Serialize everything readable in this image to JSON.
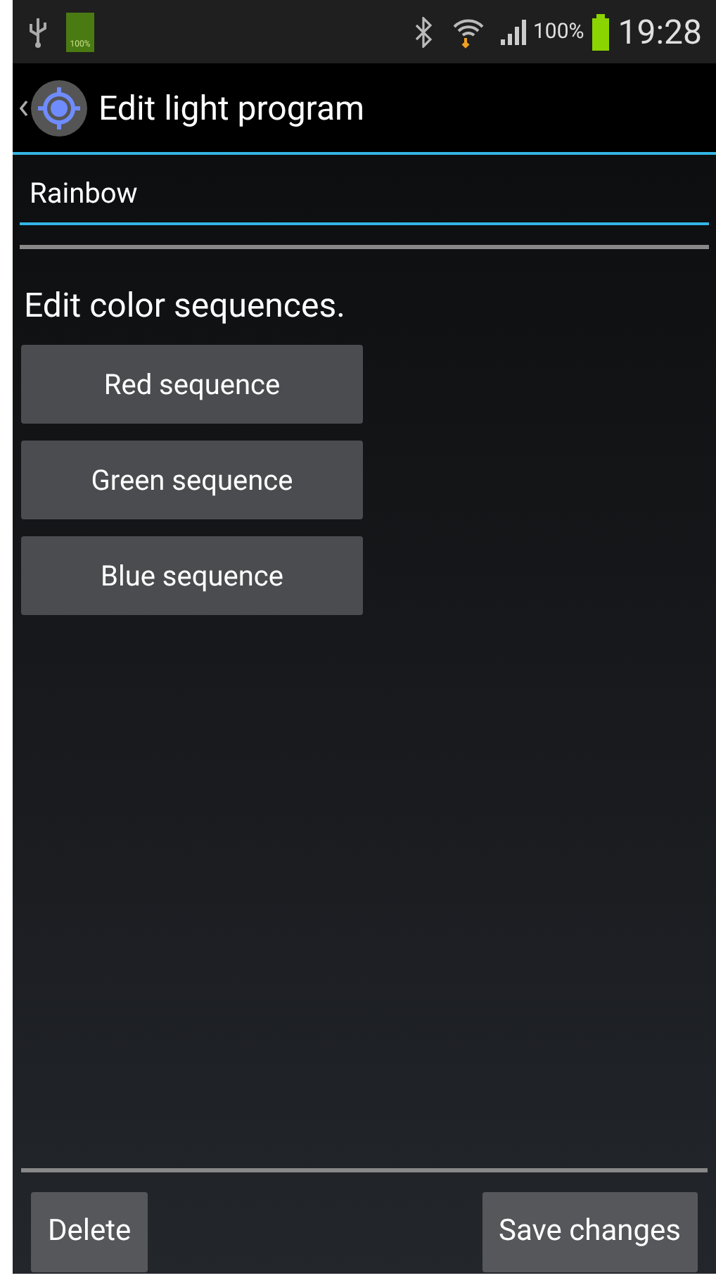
{
  "status_bar": {
    "storage_label": "100%",
    "battery": "100%",
    "time": "19:28"
  },
  "action_bar": {
    "title": "Edit light program"
  },
  "name_field": {
    "value": "Rainbow"
  },
  "heading": "Edit color sequences.",
  "sequence_buttons": [
    "Red sequence",
    "Green sequence",
    "Blue sequence"
  ],
  "footer_buttons": [
    "Delete",
    "Save changes"
  ]
}
